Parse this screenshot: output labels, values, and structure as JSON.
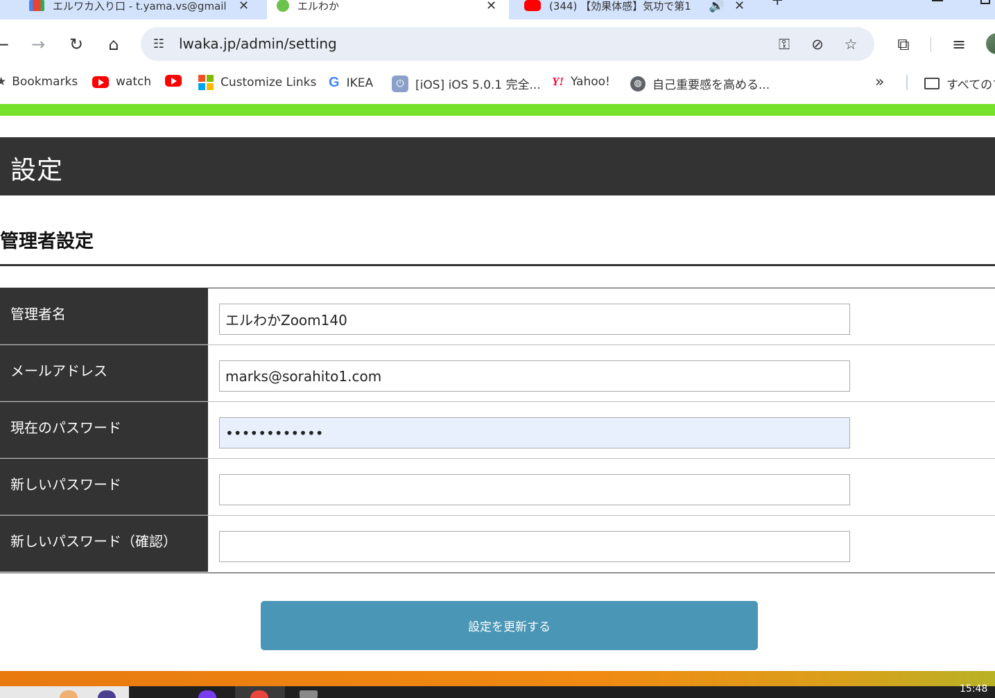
{
  "browser": {
    "tabs": [
      {
        "title": "エルワカ入り口 - t.yama.vs@gmail",
        "favicon": "gmail-icon",
        "active": false
      },
      {
        "title": "エルわか",
        "favicon": "leaf-icon",
        "active": true
      },
      {
        "title": "(344) 【効果体感】気功で第1",
        "favicon": "youtube-icon",
        "active": false
      }
    ],
    "address_bar": {
      "url": "lwaka.jp/admin/setting"
    },
    "bookmarks": [
      {
        "label": "Bookmarks",
        "icon": "star-icon"
      },
      {
        "label": "watch",
        "icon": "youtube-icon"
      },
      {
        "label": "",
        "icon": "youtube-icon"
      },
      {
        "label": "Customize Links",
        "icon": "microsoft-icon"
      },
      {
        "label": "IKEA",
        "icon": "google-icon"
      },
      {
        "label": "[iOS] iOS 5.0.1 完全...",
        "icon": "power-icon"
      },
      {
        "label": "Yahoo!",
        "icon": "yahoo-icon"
      },
      {
        "label": "自己重要感を高める...",
        "icon": "globe-icon"
      }
    ],
    "all_bookmarks_label": "すべてのブ"
  },
  "page": {
    "title": "設定",
    "section_title": "管理者設定",
    "fields": [
      {
        "label": "管理者名",
        "value": "エルわかZoom140",
        "type": "text",
        "autofilled": false
      },
      {
        "label": "メールアドレス",
        "value": "marks@sorahito1.com",
        "type": "text",
        "autofilled": false
      },
      {
        "label": "現在のパスワード",
        "value": "••••••••••••",
        "type": "password",
        "autofilled": true
      },
      {
        "label": "新しいパスワード",
        "value": "",
        "type": "password",
        "autofilled": false
      },
      {
        "label": "新しいパスワード（確認）",
        "value": "",
        "type": "password",
        "autofilled": false
      }
    ],
    "submit_label": "設定を更新する"
  },
  "taskbar": {
    "clock": "15:48"
  },
  "colors": {
    "accent_green": "#75e12a",
    "header_dark": "#333333",
    "button_blue": "#4a96b6",
    "tab_strip": "#d3e3fd",
    "autofill_bg": "#e8f0fe"
  }
}
